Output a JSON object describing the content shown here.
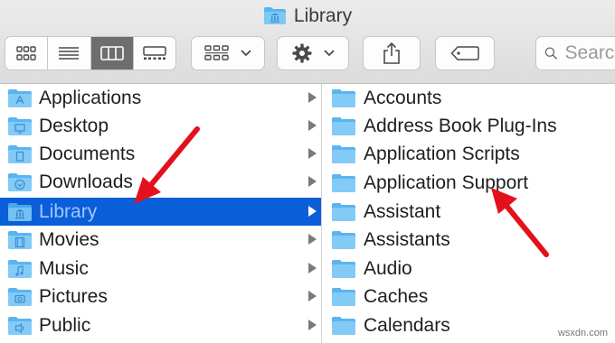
{
  "window": {
    "title": "Library"
  },
  "toolbar": {
    "view_buttons": [
      {
        "icon": "icon-view-icon",
        "active": false
      },
      {
        "icon": "list-view-icon",
        "active": false
      },
      {
        "icon": "column-view-icon",
        "active": true
      },
      {
        "icon": "gallery-view-icon",
        "active": false
      }
    ],
    "group_button": {
      "icon": "group-by-icon"
    },
    "action_button": {
      "icon": "gear-icon"
    },
    "share_button": {
      "icon": "share-icon"
    },
    "tag_button": {
      "icon": "tag-icon"
    },
    "search": {
      "placeholder": "Search"
    }
  },
  "sidebar_column": {
    "items": [
      {
        "label": "Applications",
        "icon": "applications-folder-icon",
        "selected": false
      },
      {
        "label": "Desktop",
        "icon": "desktop-folder-icon",
        "selected": false
      },
      {
        "label": "Documents",
        "icon": "documents-folder-icon",
        "selected": false
      },
      {
        "label": "Downloads",
        "icon": "downloads-folder-icon",
        "selected": false
      },
      {
        "label": "Library",
        "icon": "library-folder-icon",
        "selected": true
      },
      {
        "label": "Movies",
        "icon": "movies-folder-icon",
        "selected": false
      },
      {
        "label": "Music",
        "icon": "music-folder-icon",
        "selected": false
      },
      {
        "label": "Pictures",
        "icon": "pictures-folder-icon",
        "selected": false
      },
      {
        "label": "Public",
        "icon": "public-folder-icon",
        "selected": false
      }
    ]
  },
  "library_column": {
    "items": [
      {
        "label": "Accounts"
      },
      {
        "label": "Address Book Plug-Ins"
      },
      {
        "label": "Application Scripts"
      },
      {
        "label": "Application Support"
      },
      {
        "label": "Assistant"
      },
      {
        "label": "Assistants"
      },
      {
        "label": "Audio"
      },
      {
        "label": "Caches"
      },
      {
        "label": "Calendars"
      }
    ]
  },
  "colors": {
    "selection": "#0a5ed8",
    "folder": "#5ab4f0",
    "annotation_arrow": "#e4101b"
  },
  "watermark": "wsxdn.com"
}
